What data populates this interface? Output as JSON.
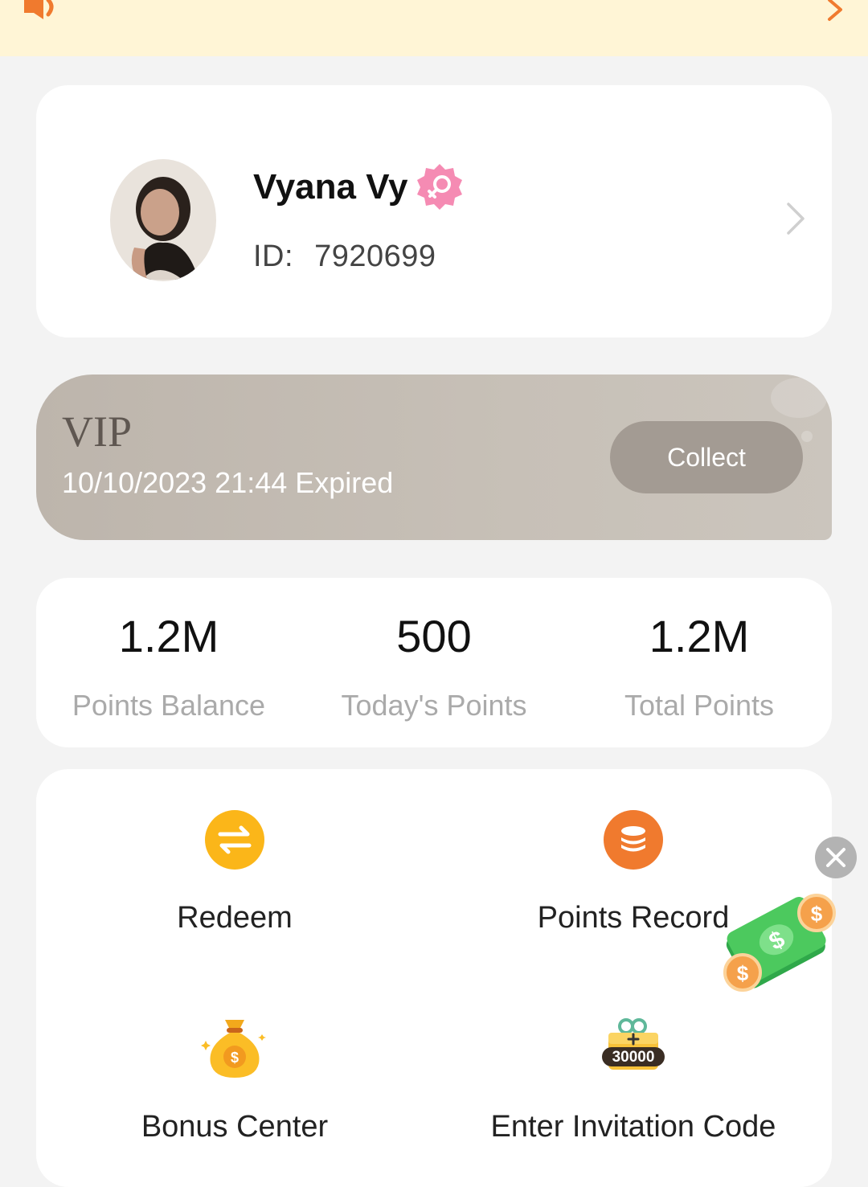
{
  "profile": {
    "name": "Vyana Vy",
    "id_label": "ID:",
    "id_value": "7920699",
    "gender_icon": "female-badge-icon"
  },
  "vip": {
    "title": "VIP",
    "expiry": "10/10/2023 21:44 Expired",
    "collect_label": "Collect"
  },
  "stats": [
    {
      "value": "1.2M",
      "label": "Points Balance"
    },
    {
      "value": "500",
      "label": "Today's Points"
    },
    {
      "value": "1.2M",
      "label": "Total Points"
    }
  ],
  "menu": [
    {
      "label": "Redeem",
      "icon": "swap-arrows-icon"
    },
    {
      "label": "Points Record",
      "icon": "coin-stack-icon"
    },
    {
      "label": "Bonus Center",
      "icon": "money-bag-icon"
    },
    {
      "label": "Enter Invitation Code",
      "icon": "gift-box-icon",
      "badge": "30000"
    }
  ],
  "colors": {
    "notice_bg": "#fff5d6",
    "accent_orange": "#f07a2e",
    "redeem_yellow": "#fbb619",
    "vip_bg": "#c3bbb2",
    "collect_bg": "#a39b93"
  }
}
